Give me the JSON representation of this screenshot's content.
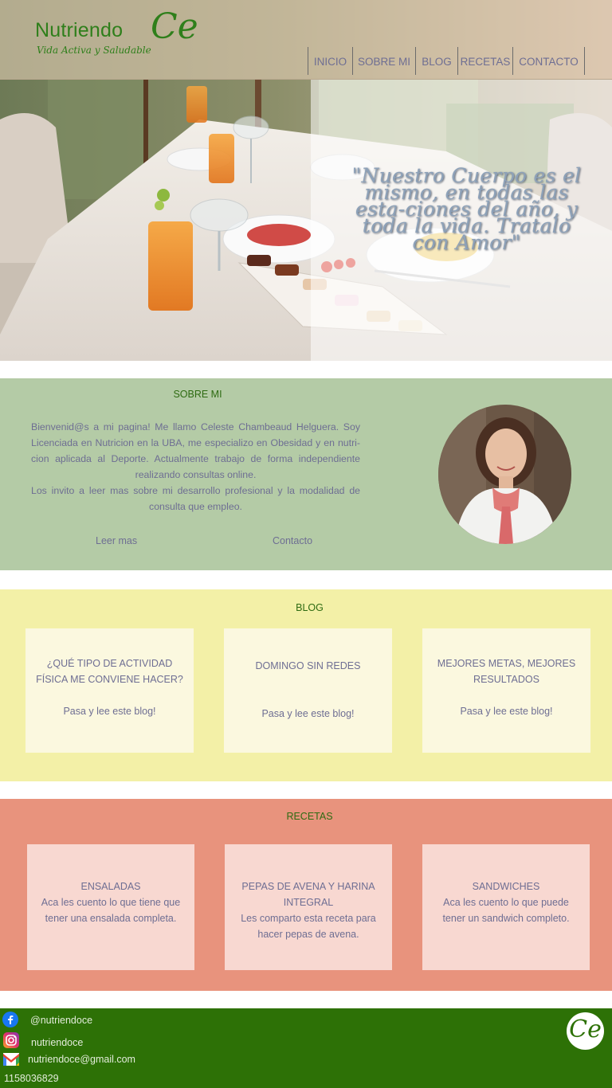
{
  "brand": {
    "name": "Nutriendo",
    "mark": "Ce",
    "tagline": "Vida Activa y Saludable"
  },
  "nav": {
    "items": [
      "INICIO",
      "SOBRE MI",
      "BLOG",
      "RECETAS",
      "CONTACTO"
    ]
  },
  "hero": {
    "quote": "\"Nuestro Cuerpo es el mismo, en todas las esta-ciones del año, y toda la vida. Tratalo con Amor\""
  },
  "about": {
    "title": "SOBRE MI",
    "paragraph_1": "Bienvenid@s a mi pagina! Me llamo Celeste Chambeaud Helguera. Soy Licenciada en Nutricion en la UBA, me especializo en Obesidad y en nutri-cion aplicada al Deporte. Actualmente trabajo de forma independiente realizando consultas online.",
    "paragraph_2": "Los invito a leer mas sobre mi desarrollo profesional y la modalidad de consulta que empleo.",
    "read_more": "Leer mas",
    "contact": "Contacto"
  },
  "blog": {
    "title": "BLOG",
    "cards": [
      {
        "title": "¿QUÉ TIPO DE ACTIVIDAD FÍSICA ME CONVIENE HACER?",
        "cta": "Pasa y lee este blog!"
      },
      {
        "title": "DOMINGO SIN REDES",
        "cta": "Pasa y lee este blog!"
      },
      {
        "title": "MEJORES METAS, MEJORES RESULTADOS",
        "cta": "Pasa y lee este blog!"
      }
    ]
  },
  "recipes": {
    "title": "RECETAS",
    "cards": [
      {
        "title": "ENSALADAS",
        "text": "Aca les cuento lo que tiene que tener una ensalada completa."
      },
      {
        "title": "PEPAS DE AVENA Y HARINA INTEGRAL",
        "text": "Les comparto esta receta para hacer pepas de avena."
      },
      {
        "title": "SANDWICHES",
        "text": "Aca les cuento lo que puede tener un sandwich completo."
      }
    ]
  },
  "footer": {
    "facebook": "@nutriendoce",
    "instagram": "nutriendoce",
    "email": "nutriendoce@gmail.com",
    "phone": "1158036829",
    "logo_mark": "Ce"
  },
  "colors": {
    "brand_green": "#2f7f1b",
    "about_bg": "#b4cba6",
    "blog_bg": "#f3f0a7",
    "recipes_bg": "#e8937d",
    "footer_bg": "#2d7106"
  }
}
